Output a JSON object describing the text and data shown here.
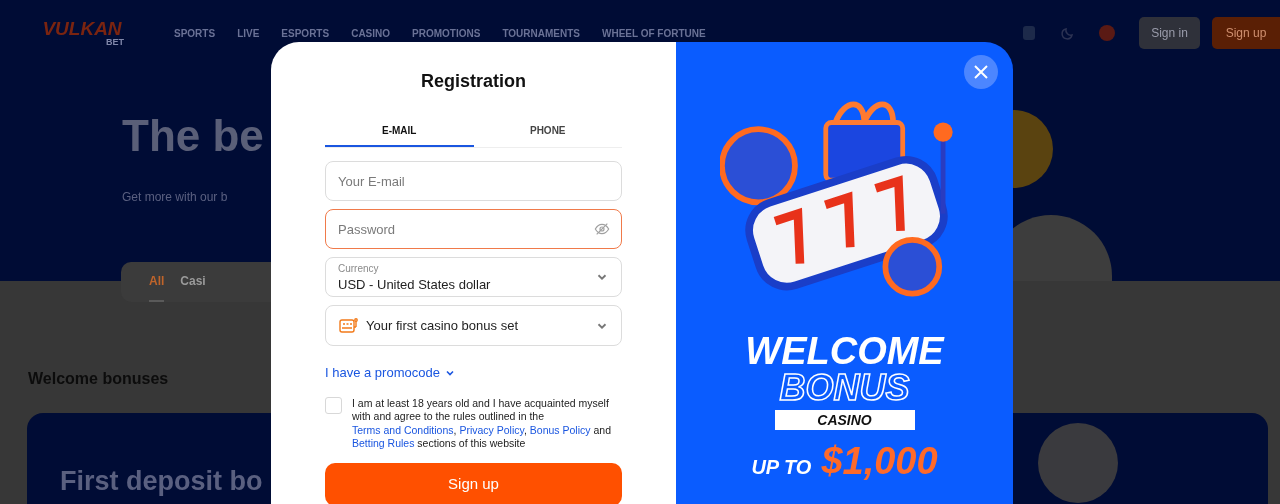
{
  "header": {
    "logo": {
      "name": "VULKAN",
      "sub": "BET"
    },
    "nav": [
      "SPORTS",
      "LIVE",
      "ESPORTS",
      "CASINO",
      "PROMOTIONS",
      "TOURNAMENTS",
      "WHEEL OF FORTUNE"
    ],
    "sign_in": "Sign in",
    "sign_up": "Sign up"
  },
  "hero": {
    "title": "The be",
    "subtitle": "Get more with our b"
  },
  "filter_tabs": [
    {
      "label": "All",
      "selected": true
    },
    {
      "label": "Casi",
      "selected": false
    }
  ],
  "section_title": "Welcome bonuses",
  "bonus_card": {
    "title": "First deposit bo"
  },
  "modal": {
    "title": "Registration",
    "tabs": [
      {
        "label": "E-MAIL",
        "selected": true
      },
      {
        "label": "PHONE",
        "selected": false
      }
    ],
    "fields": [
      {
        "kind": "text",
        "placeholder": "Your E-mail",
        "focused": false
      },
      {
        "kind": "password",
        "placeholder": "Password",
        "focused": true
      },
      {
        "kind": "select",
        "label": "Currency",
        "value": "USD - United States dollar"
      },
      {
        "kind": "bonus",
        "value": "Your first casino bonus set"
      }
    ],
    "promo_link": "I have a promocode",
    "consent": {
      "checked": false,
      "parts": [
        {
          "text": "I am at least 18 years old and I have acquainted myself with and agree to the rules outlined in the ",
          "kind": "text"
        },
        {
          "text": "Terms and Conditions",
          "kind": "link"
        },
        {
          "text": ", ",
          "kind": "text"
        },
        {
          "text": "Privacy Policy",
          "kind": "link"
        },
        {
          "text": ", ",
          "kind": "text"
        },
        {
          "text": "Bonus Policy",
          "kind": "link"
        },
        {
          "text": " and ",
          "kind": "text"
        },
        {
          "text": "Betting Rules",
          "kind": "link"
        },
        {
          "text": " sections of this website",
          "kind": "text"
        }
      ]
    },
    "submit": "Sign up"
  },
  "promo": {
    "headline": "WELCOME",
    "outline": "BONUS",
    "tag": "CASINO",
    "prefix": "UP TO",
    "amount": "$1,000"
  }
}
